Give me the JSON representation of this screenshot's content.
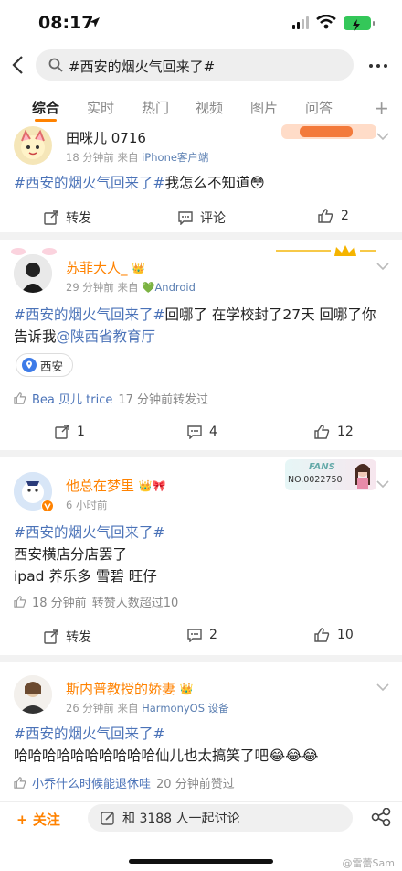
{
  "status": {
    "time": "08:17"
  },
  "search": {
    "query": "#西安的烟火气回来了#"
  },
  "tabs": [
    "综合",
    "实时",
    "热门",
    "视频",
    "图片",
    "问答"
  ],
  "posts": [
    {
      "user": "田咪儿 0716",
      "time": "18 分钟前",
      "from": "来自",
      "source": "iPhone客户端",
      "tag": "#西安的烟火气回来了#",
      "text": "我怎么不知道",
      "emoji": "😳",
      "repost": "转发",
      "comment": "评论",
      "likes": "2"
    },
    {
      "user": "苏菲大人_",
      "time": "29 分钟前",
      "from": "来自",
      "source": "Android",
      "tag": "#西安的烟火气回来了#",
      "text": "回哪了  在学校封了27天  回哪了你告诉我",
      "mention": "@陕西省教育厅",
      "location": "西安",
      "repost_by": "Bea 贝儿 trice",
      "repost_time": "17 分钟前转发过",
      "reposts": "1",
      "comments": "4",
      "likes": "12"
    },
    {
      "user": "他总在梦里",
      "time": "6 小时前",
      "tag": "#西安的烟火气回来了#",
      "line1": "西安横店分店罢了",
      "line2": "ipad 养乐多 雪碧 旺仔",
      "like_time": "18 分钟前",
      "like_note": "转赞人数超过10",
      "fans_label": "FANS",
      "fans_no": "NO.0022750",
      "repost": "转发",
      "comments": "2",
      "likes": "10"
    },
    {
      "user": "斯内普教授的娇妻",
      "time": "26 分钟前",
      "from": "来自",
      "source": "HarmonyOS 设备",
      "tag": "#西安的烟火气回来了#",
      "text": "哈哈哈哈哈哈哈哈哈哈仙儿也太搞笑了吧",
      "emoji": "😂😂😂",
      "liker": "小乔什么时候能退休哇",
      "like_note": "20 分钟前赞过"
    }
  ],
  "bottom": {
    "follow": "关注",
    "discuss": "和 3188 人一起讨论"
  },
  "watermark": "@雷蕾Sam",
  "colors": {
    "accent": "#ff8200",
    "link": "#4b73b8",
    "battery": "#34c759"
  }
}
